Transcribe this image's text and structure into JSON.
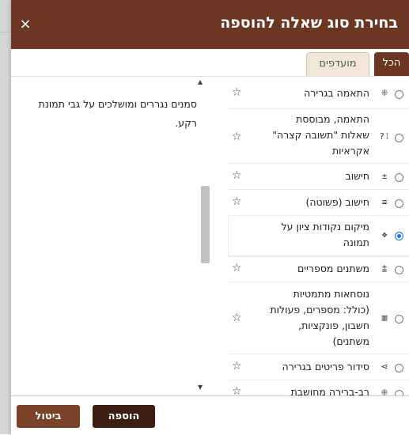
{
  "dialog": {
    "title": "בחירת סוג שאלה להוספה",
    "close_glyph": "×"
  },
  "tabs": [
    {
      "label": "הכל",
      "active": true
    },
    {
      "label": "מועדפים",
      "active": false
    }
  ],
  "question_types": [
    {
      "name": "התאמה בגרירה",
      "icon": "drag-match-icon",
      "glyph": "⁜",
      "selected": false
    },
    {
      "name": "התאמה, מבוססת שאלות \"תשובה קצרה\" אקראיות",
      "icon": "random-short-answer-match-icon",
      "glyph": "⁞?",
      "selected": false
    },
    {
      "name": "חישוב",
      "icon": "calculated-icon",
      "glyph": "±",
      "selected": false
    },
    {
      "name": "חישוב (פשוטה)",
      "icon": "calculated-simple-icon",
      "glyph": "≡",
      "selected": false
    },
    {
      "name": "מיקום נקודות ציון על תמונה",
      "icon": "drag-markers-icon",
      "glyph": "✥",
      "selected": true
    },
    {
      "name": "משתנים מספריים",
      "icon": "numeric-variables-icon",
      "glyph": "⩲",
      "selected": false
    },
    {
      "name": "נוסחאות מתמטיות (כולל: מספרים, פעולות חשבון, פונקציות, משתנים)",
      "icon": "formulas-icon",
      "glyph": "▥",
      "selected": false
    },
    {
      "name": "סידור פריטים בגרירה",
      "icon": "ordering-icon",
      "glyph": "⋗",
      "selected": false
    },
    {
      "name": "רב-ברירה מחושבת",
      "icon": "calculated-multichoice-icon",
      "glyph": "⁜",
      "selected": false
    }
  ],
  "description": "סמנים נגררים ומושלכים על גבי תמונת רקע.",
  "footer": {
    "add_label": "הוספה",
    "cancel_label": "ביטול"
  },
  "icons": {
    "favorite": "star-outline-icon",
    "star_glyph": "☆",
    "scroll_up_glyph": "▲",
    "scroll_down_glyph": "▼"
  },
  "colors": {
    "header": "#6b3723",
    "accent": "#1a73e8",
    "add_button": "#3d1e13",
    "cancel_button": "#7a4229"
  }
}
